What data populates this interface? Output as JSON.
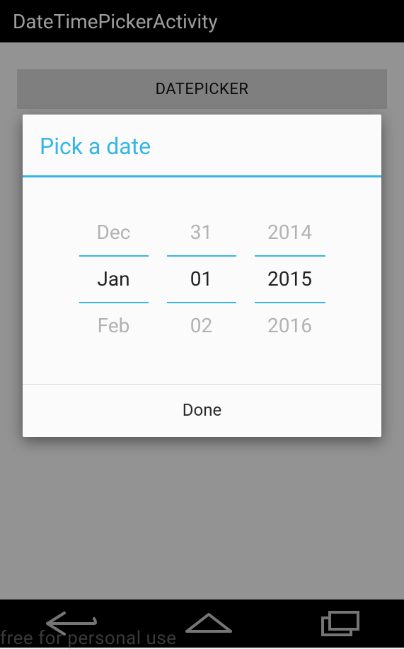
{
  "actionBar": {
    "title": "DateTimePickerActivity"
  },
  "buttons": {
    "datepicker_label": "DATEPICKER"
  },
  "dialog": {
    "title": "Pick a date",
    "month": {
      "prev": "Dec",
      "current": "Jan",
      "next": "Feb"
    },
    "day": {
      "prev": "31",
      "current": "01",
      "next": "02"
    },
    "year": {
      "prev": "2014",
      "current": "2015",
      "next": "2016"
    },
    "done_label": "Done"
  },
  "watermark": "free for personal use"
}
